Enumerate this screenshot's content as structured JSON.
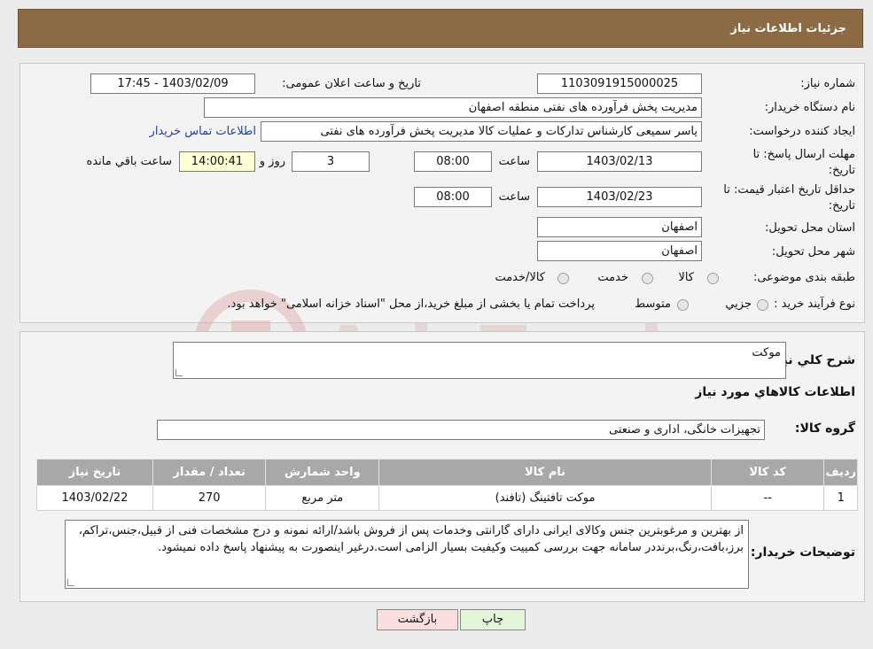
{
  "header": {
    "title": "جزئیات اطلاعات نیاز"
  },
  "info": {
    "need_number_label": "شماره نیاز:",
    "need_number": "1103091915000025",
    "announce_label": "تاریخ و ساعت اعلان عمومی:",
    "announce_value": "1403/02/09 - 17:45",
    "buyer_label": "نام دستگاه خریدار:",
    "buyer": "مدیریت پخش فرآورده های نفتی منطقه اصفهان",
    "creator_label": "ایجاد کننده درخواست:",
    "creator": "یاسر  سمیعی کارشناس تدارکات و عملیات کالا مدیریت پخش فرآورده های نفتی",
    "contact_link": "اطلاعات تماس خریدار",
    "deadline_label": "مهلت ارسال پاسخ: تا تاریخ:",
    "deadline_date": "1403/02/13",
    "time_label": "ساعت",
    "deadline_time": "08:00",
    "days_value": "3",
    "days_label": "روز و",
    "remaining_time": "14:00:41",
    "remaining_label": "ساعت باقي مانده",
    "validity_label": "حداقل تاریخ اعتبار قیمت: تا تاریخ:",
    "validity_date": "1403/02/23",
    "validity_time": "08:00",
    "province_label": "استان محل تحویل:",
    "province": "اصفهان",
    "city_label": "شهر محل تحویل:",
    "city": "اصفهان",
    "category_label": "طبقه بندی موضوعی:",
    "category_options": [
      "کالا",
      "خدمت",
      "کالا/خدمت"
    ],
    "process_label": "نوع فرآیند خرید :",
    "process_options": [
      "جزیي",
      "متوسط"
    ],
    "process_note": "پرداخت تمام یا بخشی از مبلغ خرید،از محل \"اسناد خزانه اسلامی\" خواهد بود."
  },
  "details": {
    "summary_label": "شرح کلي نياز:",
    "summary": "موکت",
    "goods_title": "اطلاعات کالاهاي مورد نياز",
    "group_label": "گروه کالا:",
    "group": "تجهیزات خانگی، اداری و صنعتی",
    "table": {
      "headers": [
        "رديف",
        "کد کالا",
        "نام کالا",
        "واحد شمارش",
        "تعداد / مقدار",
        "تاریخ نیاز"
      ],
      "rows": [
        [
          "1",
          "--",
          "موکت تافتینگ (تافند)",
          "متر مربع",
          "270",
          "1403/02/22"
        ]
      ]
    },
    "buyer_notes_label": "توضیحات خریدار:",
    "buyer_notes": "از بهترین و مرغوبترین جنس وکالای ایرانی دارای گارانتی وخدمات پس از فروش باشد/ارائه نمونه و درج مشخصات فنی از قبیل،جنس،تراکم، برز،بافت،رنگ،برنددر سامانه جهت بررسی کمییت وکیفیت بسیار الزامی است.درغیر اینصورت به پیشنهاد پاسخ داده نمیشود."
  },
  "buttons": {
    "back": "بازگشت",
    "print": "چاپ"
  },
  "colors": {
    "header_bg": "#8c6a43",
    "back_btn_bg": "#f9dede",
    "print_btn_bg": "#e3f7d8"
  }
}
